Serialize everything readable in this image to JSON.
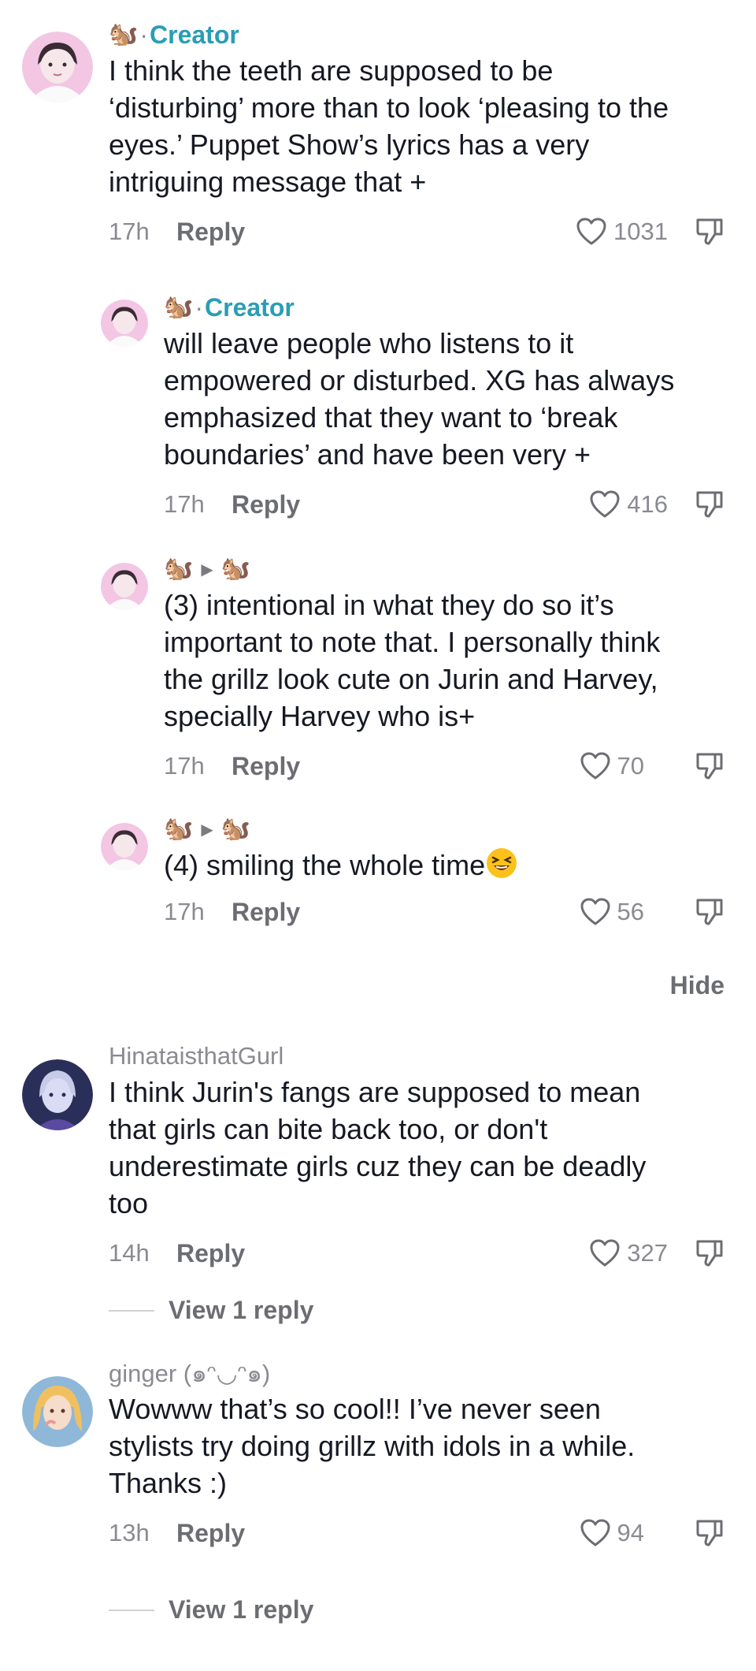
{
  "comments": [
    {
      "id": "c1",
      "type": "creator",
      "badge": "Creator",
      "text": "I think the teeth are supposed to be\n‘disturbing’ more than to look ‘pleasing to the\neyes.’ Puppet Show’s lyrics has a very\nintriguing message that +",
      "time": "17h",
      "reply_label": "Reply",
      "likes": "1031"
    },
    {
      "id": "r1",
      "type": "creator",
      "badge": "Creator",
      "text": "will leave people who listens to it\nempowered or disturbed. XG has always\nemphasized that they want to ‘break\nboundaries’ and have been very +",
      "time": "17h",
      "reply_label": "Reply",
      "likes": "416"
    },
    {
      "id": "r2",
      "type": "reply-to",
      "text": "(3) intentional in what they do so it’s\nimportant to note that. I personally think\nthe grillz look cute on Jurin and Harvey,\nspecially Harvey who is+",
      "time": "17h",
      "reply_label": "Reply",
      "likes": "70"
    },
    {
      "id": "r3",
      "type": "reply-to",
      "text": "(4) smiling the whole time",
      "time": "17h",
      "reply_label": "Reply",
      "likes": "56"
    },
    {
      "id": "c2",
      "type": "user",
      "username": "HinataisthatGurl",
      "text": "I think Jurin's fangs are supposed to mean\nthat girls can bite back too, or don't\nunderestimate girls cuz they can be deadly\ntoo",
      "time": "14h",
      "reply_label": "Reply",
      "likes": "327",
      "view_replies": "View 1 reply"
    },
    {
      "id": "c3",
      "type": "user",
      "username": "ginger (๑ᵔ◡ᵔ๑)",
      "text": "Wowww that’s so cool!! I’ve never seen\nstylists try doing grillz with idols in a while.\nThanks :)",
      "time": "13h",
      "reply_label": "Reply",
      "likes": "94",
      "view_replies": "View 1 reply"
    }
  ],
  "hide_label": "Hide",
  "icons": {
    "creator_badge": "squirrel-emoji",
    "reply_arrow": "play-arrow-icon",
    "like": "heart-outline-icon",
    "dislike": "thumbs-down-icon",
    "emoji": "laughing-face-emoji"
  },
  "colors": {
    "creator_accent": "#2a9db5",
    "text": "#161823",
    "muted": "#8a8b91"
  }
}
